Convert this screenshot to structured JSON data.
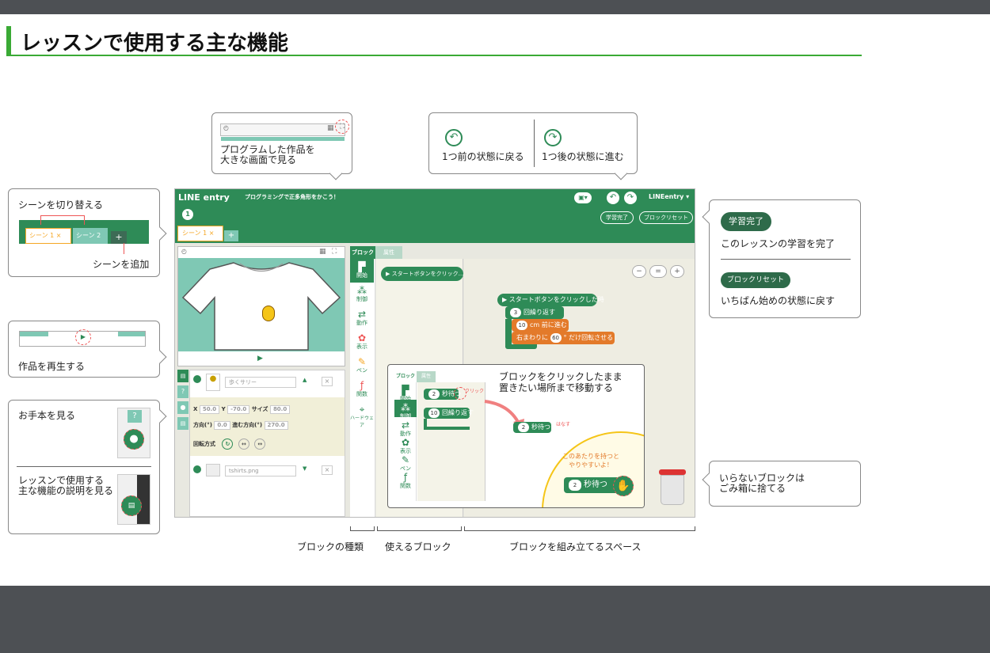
{
  "page": {
    "title": "レッスンで使用する主な機能"
  },
  "callouts": {
    "fullscreen": "プログラムした作品を\n大きな画面で見る",
    "undo": "1つ前の状態に戻る",
    "redo": "1つ後の状態に進む",
    "scene_switch": "シーンを切り替える",
    "scene_add": "シーンを追加",
    "play": "作品を再生する",
    "example": "お手本を見る",
    "help": "レッスンで使用する\n主な機能の説明を見る",
    "lesson_complete_btn": "学習完了",
    "lesson_complete_desc": "このレッスンの学習を完了",
    "block_reset_btn": "ブロックリセット",
    "block_reset_desc": "いちばん始めの状態に戻す",
    "trash": "いらないブロックは\nごみ箱に捨てる",
    "drag": "ブロックをクリックしたまま\n置きたい場所まで移動する",
    "hold_hint": "このあたりを持つと\nやりやすいよ！"
  },
  "scenes": {
    "scene1": "シーン 1",
    "scene2": "シーン 2",
    "add": "+",
    "close": "×"
  },
  "app": {
    "logo": "LINE entry",
    "mission": "プログラミングで正多角形をかこう！",
    "step": "1",
    "account": "LINEentry ▾",
    "btn_complete": "学習完了",
    "btn_reset": "ブロックリセット",
    "tab_block": "ブロック",
    "tab_attr": "属性",
    "zoom": [
      "−",
      "=",
      "+"
    ],
    "categories": [
      {
        "icon": "▛",
        "label": "開始"
      },
      {
        "icon": "⁂",
        "label": "制御"
      },
      {
        "icon": "⇄",
        "label": "動作"
      },
      {
        "icon": "✿",
        "label": "表示"
      },
      {
        "icon": "✎",
        "label": "ペン"
      },
      {
        "icon": "ƒ",
        "label": "関数"
      },
      {
        "icon": "⌖",
        "label": "ハードウェア"
      }
    ],
    "palette_start": "スタートボタンをクリック…",
    "script": {
      "start": "スタートボタンをクリックした時",
      "repeat_n": "3",
      "repeat": "回繰り返す",
      "move_n": "10",
      "move": "cm 前に進む",
      "turn_pre": "右まわりに",
      "turn_n": "60",
      "turn_post": "° だけ回転させる"
    },
    "object": {
      "name": "歩くサリー",
      "x_label": "X",
      "x": "50.0",
      "y_label": "Y",
      "y": "-70.0",
      "size_label": "サイズ",
      "size": "80.0",
      "dir_label": "方向(°)",
      "dir": "0.0",
      "move_dir_label": "進む方向(°)",
      "move_dir": "270.0",
      "rotate_label": "回転方式",
      "background": "tshirts.png"
    },
    "inset": {
      "tab_block": "ブロック",
      "tab_attr": "属性",
      "wait_n": "2",
      "wait": "秒待つ",
      "repeat_n": "10",
      "repeat": "回繰り返す",
      "click": "クリック",
      "release": "はなす"
    }
  },
  "labels": {
    "block_types": "ブロックの種類",
    "available_blocks": "使えるブロック",
    "build_space": "ブロックを組み立てるスペース"
  },
  "colors": {
    "accent": "#3aaa35",
    "app_green": "#2e8b57",
    "teal": "#7fc8b4",
    "orange": "#f5a623",
    "dark": "#4d5054"
  }
}
